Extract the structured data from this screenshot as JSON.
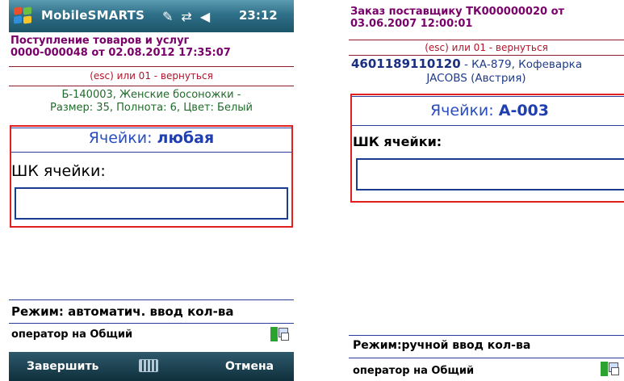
{
  "left": {
    "statusbar": {
      "app_name": "MobileSMARTS",
      "time": "23:12",
      "icons": [
        "windows-start-icon",
        "edit-icon",
        "connectivity-icon",
        "volume-icon"
      ]
    },
    "doc_title_line1": "Поступление товаров и услуг",
    "doc_title_line2": "0000-000048 от 02.08.2012 17:35:07",
    "esc_hint": "(esc) или 01 - вернуться",
    "product_line1": "Б-140003, Женские босоножки -",
    "product_line2": "Размер: 35, Полнота: 6, Цвет: Белый",
    "cell_label": "Ячейки:",
    "cell_value": "любая",
    "barcode_label": "ШК ячейки:",
    "barcode_value": "",
    "mode": "Режим: автоматич. ввод кол-ва",
    "operator": "оператор на Общий",
    "softkeys": {
      "left": "Завершить",
      "right": "Отмена"
    }
  },
  "right": {
    "doc_title_line1": "Заказ поставщику ТК000000020 от",
    "doc_title_line2": "03.06.2007 12:00:01",
    "esc_hint": "(esc) или 01 - вернуться",
    "product_code": "4601189110120",
    "product_rest": " - КА-879, Кофеварка",
    "product_line2": "JACOBS (Австрия)",
    "cell_label": "Ячейки:",
    "cell_value": "А-003",
    "barcode_label": "ШК ячейки:",
    "barcode_value": "",
    "mode": "Режим:ручной ввод кол-ва",
    "operator": "оператор на Общий"
  },
  "colors": {
    "title_purple": "#7a006a",
    "hint_red": "#b3142c",
    "product_green": "#1f6b2a",
    "cell_blue": "#2a4ebf",
    "frame_red": "#e0201f",
    "titlebar_teal": "#2f7089"
  }
}
